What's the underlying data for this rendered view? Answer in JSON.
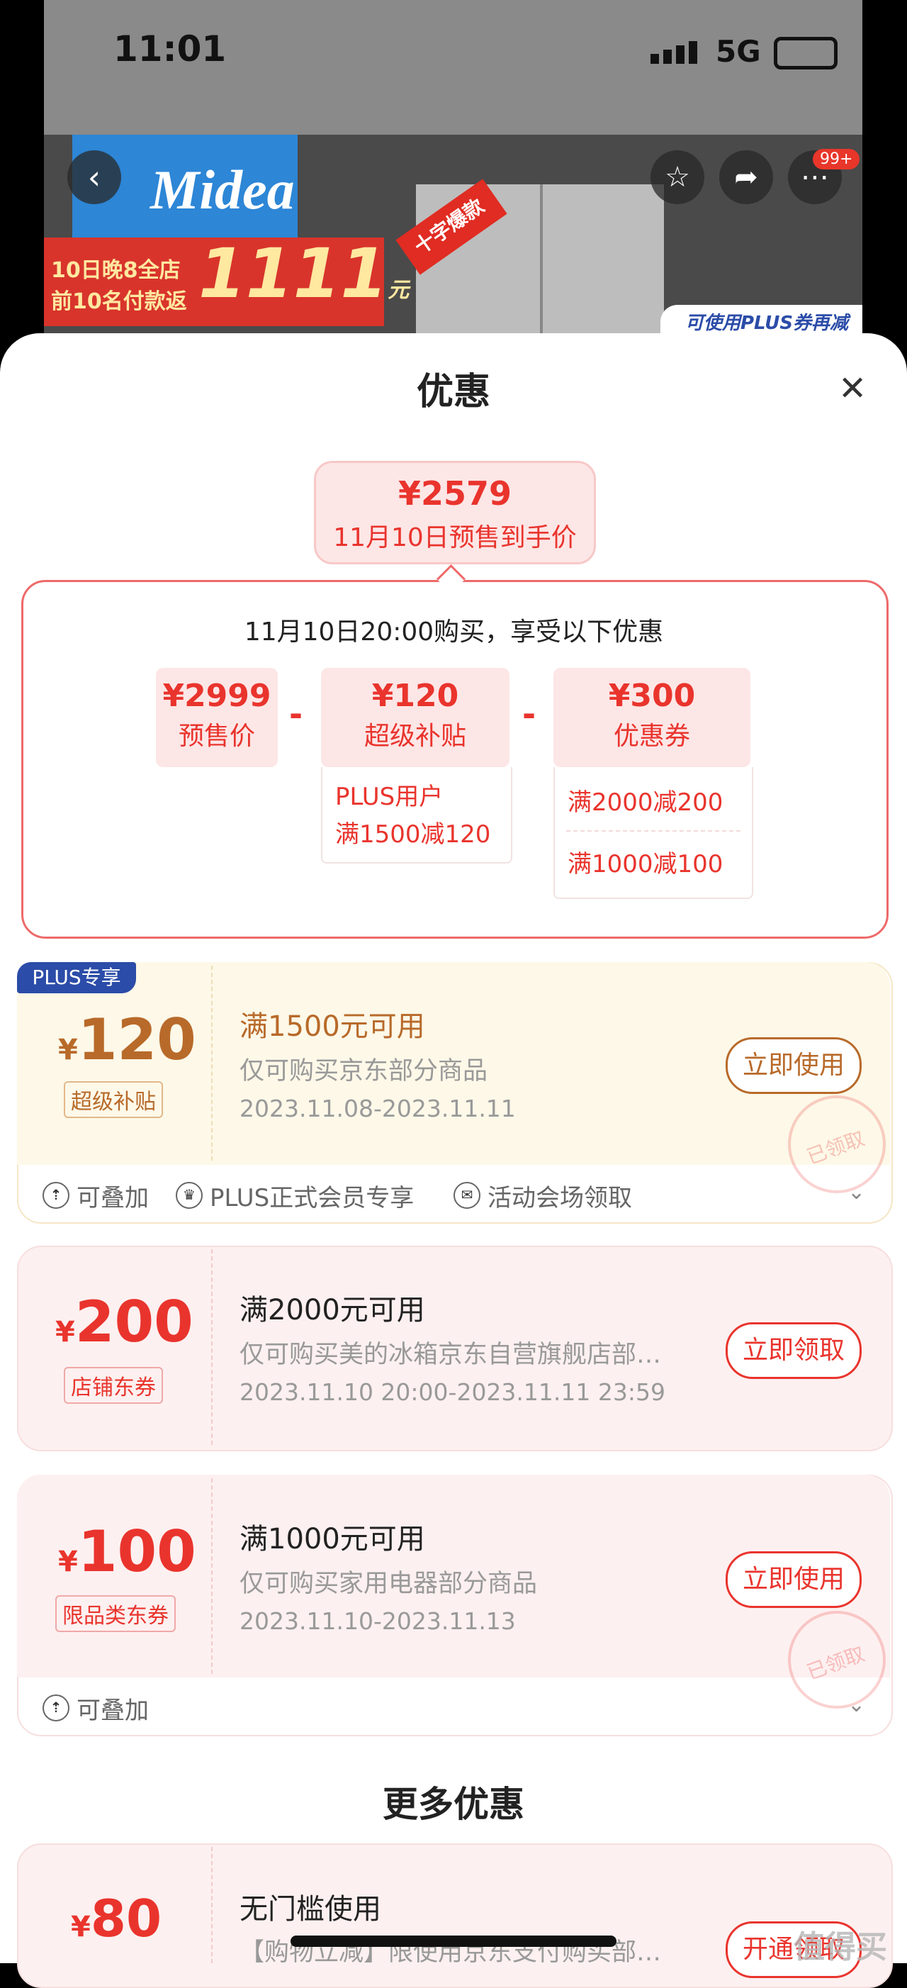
{
  "status_bar": {
    "time": "11:01",
    "network": "5G"
  },
  "hero": {
    "brand": "Midea",
    "promo_line1": "10日晚8全店",
    "promo_line2": "前10名付款返",
    "promo_big": "1111",
    "promo_unit": "元",
    "ribbon": "十字爆款",
    "plus_tag": "可使用PLUS券再减",
    "badge": "99+"
  },
  "sheet": {
    "title": "优惠",
    "close_icon": "close-icon"
  },
  "final_price": {
    "price": "¥2579",
    "label": "11月10日预售到手价"
  },
  "calc": {
    "heading": "11月10日20:00购买，享受以下优惠",
    "items": [
      {
        "value": "¥2999",
        "label": "预售价"
      },
      {
        "value": "¥120",
        "label": "超级补贴",
        "details": [
          "PLUS用户",
          "满1500减120"
        ]
      },
      {
        "value": "¥300",
        "label": "优惠券",
        "details": [
          "满2000减200",
          "满1000减100"
        ]
      }
    ],
    "operator": "-"
  },
  "coupons": [
    {
      "badge": "PLUS专享",
      "yen": "¥",
      "amount": "120",
      "tag": "超级补贴",
      "title": "满1500元可用",
      "desc": "仅可购买京东部分商品",
      "date": "2023.11.08-2023.11.11",
      "button": "立即使用",
      "stamp": "已领取",
      "footer": [
        "可叠加",
        "PLUS正式会员专享",
        "活动会场领取"
      ]
    },
    {
      "yen": "¥",
      "amount": "200",
      "tag": "店铺东券",
      "title": "满2000元可用",
      "desc": "仅可购买美的冰箱京东自营旗舰店部…",
      "date": "2023.11.10 20:00-2023.11.11 23:59",
      "button": "立即领取"
    },
    {
      "yen": "¥",
      "amount": "100",
      "tag": "限品类东券",
      "title": "满1000元可用",
      "desc": "仅可购买家用电器部分商品",
      "date": "2023.11.10-2023.11.13",
      "button": "立即使用",
      "stamp": "已领取",
      "footer": [
        "可叠加"
      ]
    },
    {
      "yen": "¥",
      "amount": "80",
      "title": "无门槛使用",
      "desc": "【购物立减】限使用京东支付购买部…",
      "button": "开通领取"
    }
  ],
  "more_title": "更多优惠",
  "watermark": "值得买",
  "colors": {
    "accent": "#e9342d",
    "gold": "#b86a2a",
    "plus_blue": "#2b4ca8"
  }
}
